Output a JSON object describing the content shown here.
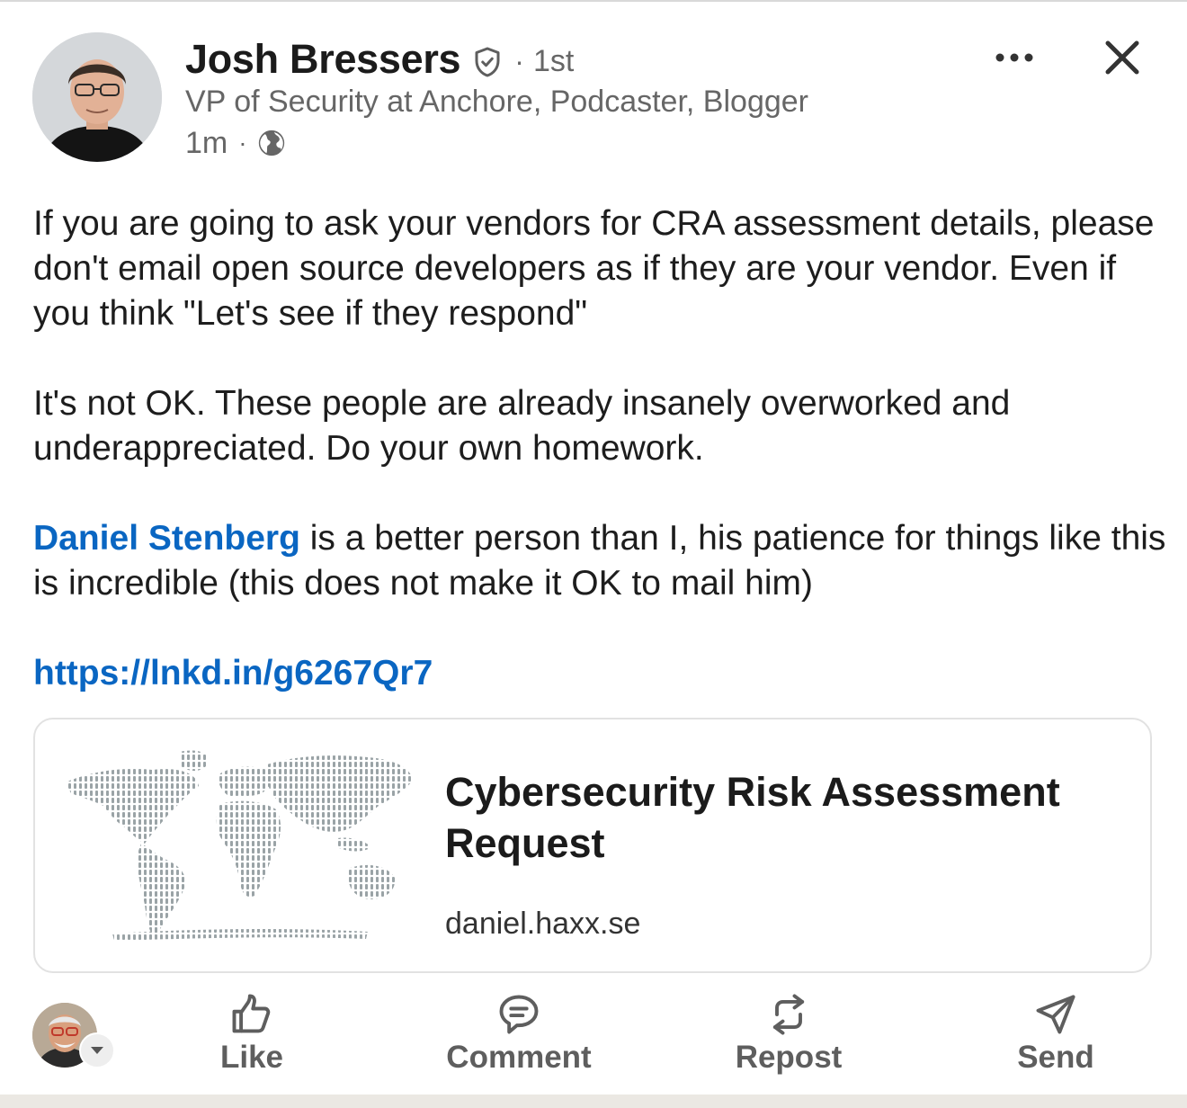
{
  "post": {
    "author_name": "Josh Bressers",
    "connection_degree": "1st",
    "separator": "·",
    "headline": "VP of Security at Anchore, Podcaster, Blogger",
    "time_ago": "1m",
    "visibility_icon": "globe-icon",
    "paragraph1": "If you are going to ask your vendors for CRA assessment details, please don't email open source developers as if they are your vendor. Even if you think \"Let's see if they respond\"",
    "paragraph2": "It's not OK. These people are already insanely overworked and underappreciated. Do your own homework.",
    "mention": "Daniel Stenberg",
    "paragraph3_rest": " is a better person than I, his patience for things like this is incredible (this does not make it OK to mail him)",
    "link": "https://lnkd.in/g6267Qr7"
  },
  "preview": {
    "title": "Cybersecurity Risk Assessment Request",
    "domain": "daniel.haxx.se"
  },
  "actions": {
    "like": "Like",
    "comment": "Comment",
    "repost": "Repost",
    "send": "Send"
  },
  "colors": {
    "link_blue": "#0a66c2",
    "secondary_text": "#666666",
    "action_gray": "#5e5e5e"
  }
}
